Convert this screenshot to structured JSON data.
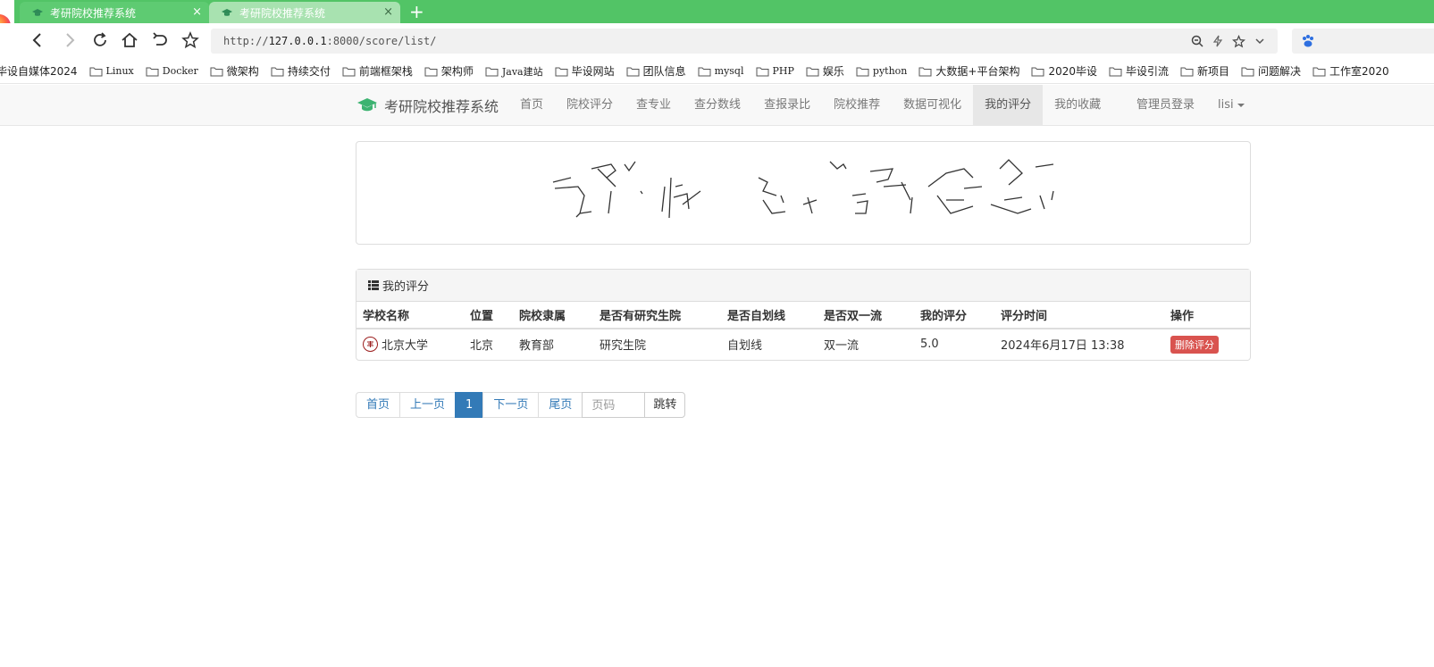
{
  "browser": {
    "tabs": [
      {
        "title": "考研院校推荐系统",
        "close": "×"
      },
      {
        "title": "考研院校推荐系统",
        "close": "×"
      }
    ],
    "new_tab": "+",
    "url_host": "127.0.0.1",
    "url_rest": ":8000/score/list/",
    "url_scheme": "http://",
    "bookmarks": [
      "毕设自媒体2024",
      "Linux",
      "Docker",
      "微架构",
      "持续交付",
      "前端框架栈",
      "架构师",
      "Java建站",
      "毕设网站",
      "团队信息",
      "mysql",
      "PHP",
      "娱乐",
      "python",
      "大数据+平台架构",
      "2020毕设",
      "毕设引流",
      "新项目",
      "问题解决",
      "工作室2020"
    ]
  },
  "nav": {
    "brand": "考研院校推荐系统",
    "items": [
      "首页",
      "院校评分",
      "查专业",
      "查分数线",
      "查报录比",
      "院校推荐",
      "数据可视化",
      "我的评分",
      "我的收藏"
    ],
    "active": "我的评分",
    "admin_login": "管理员登录",
    "user": "lisi"
  },
  "panel": {
    "title": "我的评分",
    "columns": [
      "学校名称",
      "位置",
      "院校隶属",
      "是否有研究生院",
      "是否自划线",
      "是否双一流",
      "我的评分",
      "评分时间",
      "操作"
    ],
    "rows": [
      {
        "name": "北京大学",
        "location": "北京",
        "affiliation": "教育部",
        "grad_school": "研究生院",
        "self_line": "自划线",
        "double_first": "双一流",
        "score": "5.0",
        "time": "2024年6月17日 13:38",
        "action": "删除评分"
      }
    ]
  },
  "pagination": {
    "first": "首页",
    "prev": "上一页",
    "current": "1",
    "next": "下一页",
    "last": "尾页",
    "input_placeholder": "页码",
    "go": "跳转"
  },
  "colors": {
    "tabbar": "#52c466",
    "primary": "#337ab7",
    "danger": "#d9534f",
    "brand_icon": "#3cb371"
  }
}
